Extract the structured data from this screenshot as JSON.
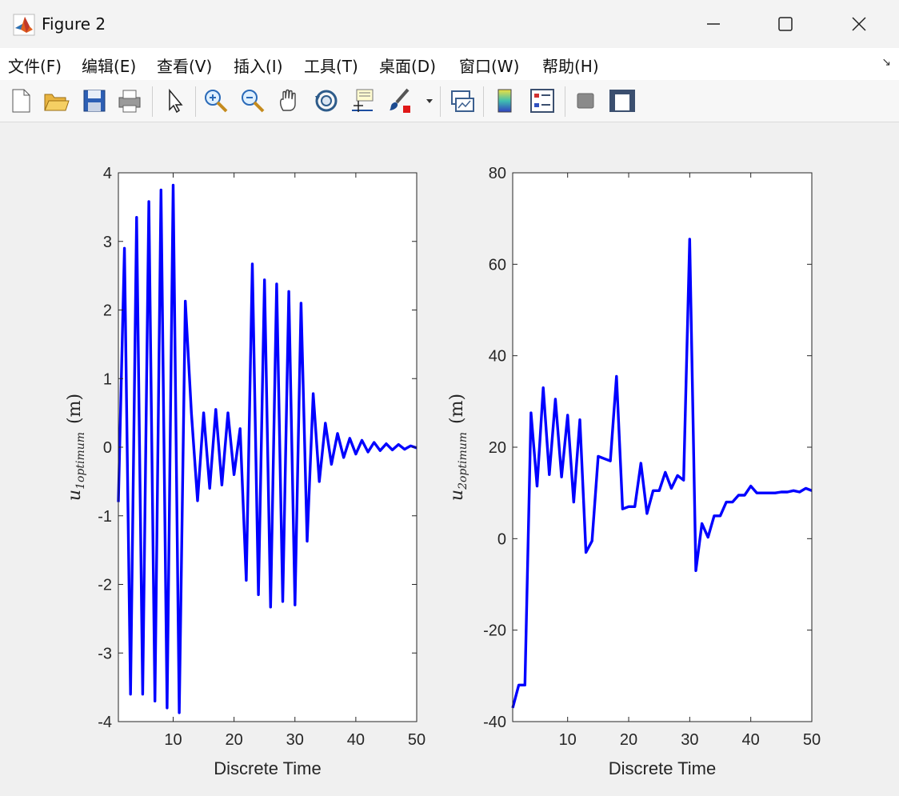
{
  "window": {
    "title": "Figure 2"
  },
  "menu": [
    "文件(F)",
    "编辑(E)",
    "查看(V)",
    "插入(I)",
    "工具(T)",
    "桌面(D)",
    "窗口(W)",
    "帮助(H)"
  ],
  "toolbar": {
    "icons": [
      "new-file-icon",
      "open-folder-icon",
      "save-icon",
      "print-icon",
      "pointer-arrow-icon",
      "zoom-in-icon",
      "zoom-out-icon",
      "pan-hand-icon",
      "rotate-3d-icon",
      "data-cursor-icon",
      "brush-icon",
      "brush-dropdown-icon",
      "link-plot-icon",
      "colorbar-icon",
      "legend-icon",
      "hide-plot-tools-icon",
      "show-plot-tools-icon"
    ]
  },
  "colors": {
    "line": "#0000ff",
    "axes": "#262626",
    "plot_bg": "#ffffff",
    "figure_bg": "#f0f0f0"
  },
  "chart_data": [
    {
      "type": "line",
      "xlabel": "Discrete Time",
      "ylabel": "u_{1optimum} (m)",
      "ylabel_main": "u",
      "ylabel_sub": "1optimum",
      "ylabel_unit": "(m)",
      "xlim": [
        1,
        50
      ],
      "ylim": [
        -4,
        4
      ],
      "xticks": [
        10,
        20,
        30,
        40,
        50
      ],
      "yticks": [
        -4,
        -3,
        -2,
        -1,
        0,
        1,
        2,
        3,
        4
      ],
      "series": [
        {
          "color": "#0000ff",
          "x": [
            1,
            2,
            3,
            4,
            5,
            6,
            7,
            8,
            9,
            10,
            11,
            12,
            13,
            14,
            15,
            16,
            17,
            18,
            19,
            20,
            21,
            22,
            23,
            24,
            25,
            26,
            27,
            28,
            29,
            30,
            31,
            32,
            33,
            34,
            35,
            36,
            37,
            38,
            39,
            40,
            41,
            42,
            43,
            44,
            45,
            46,
            47,
            48,
            49,
            50
          ],
          "y": [
            -0.8,
            2.9,
            -3.6,
            3.35,
            -3.6,
            3.58,
            -3.7,
            3.75,
            -3.8,
            3.82,
            -3.87,
            2.13,
            0.5,
            -0.78,
            0.5,
            -0.6,
            0.55,
            -0.55,
            0.5,
            -0.4,
            0.27,
            -1.94,
            2.67,
            -2.15,
            2.44,
            -2.33,
            2.38,
            -2.25,
            2.27,
            -2.3,
            2.1,
            -1.37,
            0.78,
            -0.5,
            0.35,
            -0.25,
            0.2,
            -0.15,
            0.13,
            -0.1,
            0.1,
            -0.07,
            0.07,
            -0.05,
            0.05,
            -0.04,
            0.04,
            -0.03,
            0.02,
            -0.01
          ]
        }
      ]
    },
    {
      "type": "line",
      "xlabel": "Discrete Time",
      "ylabel": "u_{2optimum} (m)",
      "ylabel_main": "u",
      "ylabel_sub": "2optimum",
      "ylabel_unit": "(m)",
      "xlim": [
        1,
        50
      ],
      "ylim": [
        -40,
        80
      ],
      "xticks": [
        10,
        20,
        30,
        40,
        50
      ],
      "yticks": [
        -40,
        -20,
        0,
        20,
        40,
        60,
        80
      ],
      "series": [
        {
          "color": "#0000ff",
          "x": [
            1,
            2,
            3,
            4,
            5,
            6,
            7,
            8,
            9,
            10,
            11,
            12,
            13,
            14,
            15,
            16,
            17,
            18,
            19,
            20,
            21,
            22,
            23,
            24,
            25,
            26,
            27,
            28,
            29,
            30,
            31,
            32,
            33,
            34,
            35,
            36,
            37,
            38,
            39,
            40,
            41,
            42,
            43,
            44,
            45,
            46,
            47,
            48,
            49,
            50
          ],
          "y": [
            -37,
            -32,
            -32,
            27.5,
            11.5,
            33,
            14,
            30.5,
            13.5,
            27,
            8,
            26,
            -3,
            -0.5,
            18,
            17.5,
            17,
            35.5,
            6.5,
            7,
            7,
            16.5,
            5.5,
            10.5,
            10.5,
            14.5,
            11,
            13.8,
            12.8,
            65.5,
            -7,
            3.3,
            0.3,
            5,
            5,
            8,
            8,
            9.5,
            9.5,
            11.5,
            10,
            10,
            10,
            10,
            10.2,
            10.2,
            10.5,
            10.2,
            11,
            10.5
          ]
        }
      ]
    }
  ]
}
